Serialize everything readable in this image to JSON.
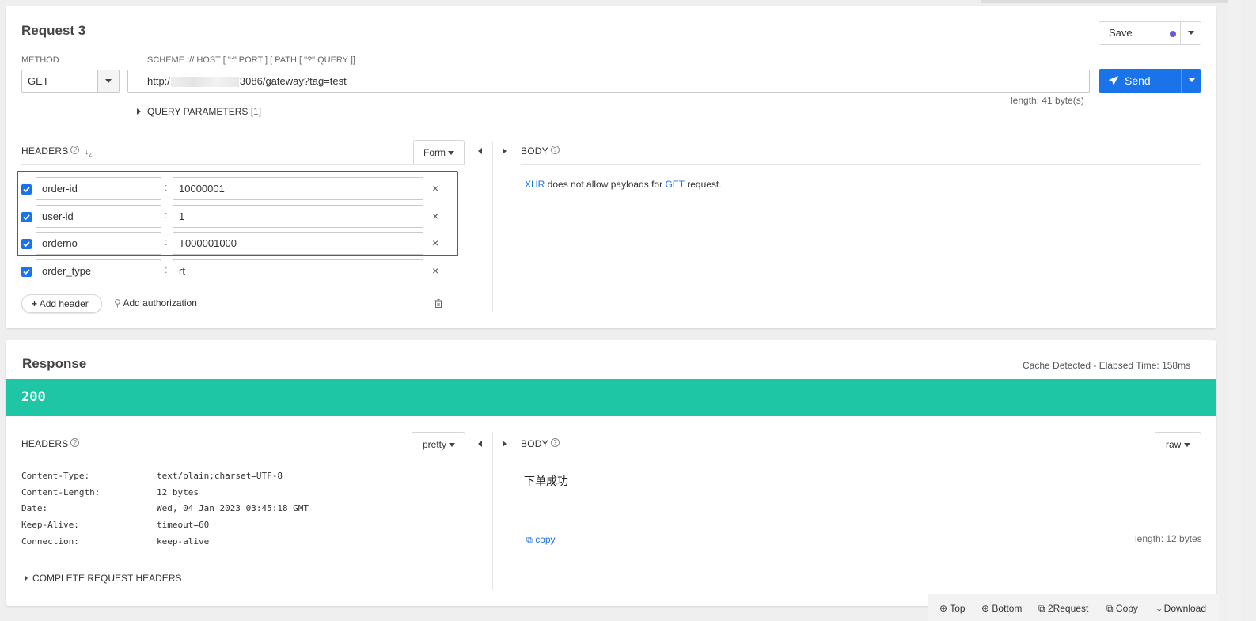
{
  "request": {
    "title": "Request 3",
    "method_label": "METHOD",
    "method_value": "GET",
    "url_label": "SCHEME :// HOST [ \":\" PORT ] [ PATH [ \"?\" QUERY ]]",
    "url_prefix": "http:/",
    "url_suffix": "3086/gateway?tag=test",
    "url_length": "length: 41 byte(s)",
    "query_params_label": "QUERY PARAMETERS",
    "query_params_count": "[1]",
    "save_label": "Save",
    "send_label": "Send",
    "headers_label": "HEADERS",
    "headers_mode": "Form",
    "body_label": "BODY",
    "body_message_xhr": "XHR",
    "body_message_mid": " does not allow payloads for ",
    "body_message_get": "GET",
    "body_message_end": " request.",
    "headers": [
      {
        "name": "order-id",
        "value": "10000001",
        "checked": true
      },
      {
        "name": "user-id",
        "value": "1",
        "checked": true
      },
      {
        "name": "orderno",
        "value": "T000001000",
        "checked": true
      },
      {
        "name": "order_type",
        "value": "rt",
        "checked": true
      }
    ],
    "add_header_label": "Add header",
    "add_auth_label": "Add authorization"
  },
  "response": {
    "title": "Response",
    "elapsed": "Cache Detected - Elapsed Time: 158ms",
    "status_code": "200",
    "status_color": "#1ec6a6",
    "headers_label": "HEADERS",
    "headers_mode": "pretty",
    "body_label": "BODY",
    "body_mode": "raw",
    "body_text": "下单成功",
    "copy_label": "copy",
    "body_length": "length: 12 bytes",
    "headers": [
      {
        "name": "Content-Type:",
        "value": "text/plain;charset=UTF-8"
      },
      {
        "name": "Content-Length:",
        "value": "12 bytes"
      },
      {
        "name": "Date:",
        "value": "Wed, 04 Jan 2023 03:45:18 GMT"
      },
      {
        "name": "Keep-Alive:",
        "value": "timeout=60"
      },
      {
        "name": "Connection:",
        "value": "keep-alive"
      }
    ],
    "complete_request_headers_label": "COMPLETE REQUEST HEADERS"
  },
  "footer": {
    "top": "Top",
    "bottom": "Bottom",
    "to_request": "2Request",
    "copy": "Copy",
    "download": "Download"
  },
  "colors": {
    "accent": "#1a73e8",
    "send_button": "#1a73e8",
    "highlight_box": "#e52222"
  }
}
